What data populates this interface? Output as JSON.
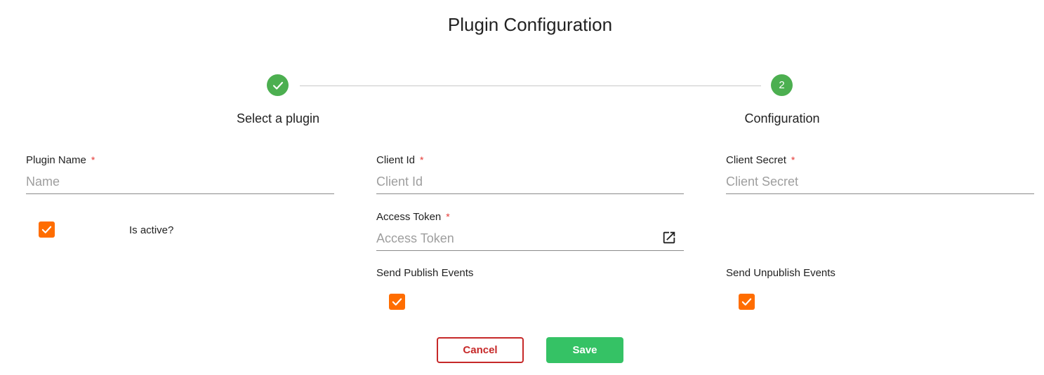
{
  "page": {
    "title": "Plugin Configuration"
  },
  "stepper": {
    "steps": [
      {
        "label": "Select a plugin",
        "status": "completed",
        "icon": "check-icon"
      },
      {
        "label": "Configuration",
        "status": "active",
        "number": "2"
      }
    ],
    "active_color": "#4caf50"
  },
  "form": {
    "plugin_name": {
      "label": "Plugin Name",
      "required_mark": "*",
      "placeholder": "Name",
      "value": ""
    },
    "client_id": {
      "label": "Client Id",
      "required_mark": "*",
      "placeholder": "Client Id",
      "value": ""
    },
    "client_secret": {
      "label": "Client Secret",
      "required_mark": "*",
      "placeholder": "Client Secret",
      "value": ""
    },
    "access_token": {
      "label": "Access Token",
      "required_mark": "*",
      "placeholder": "Access Token",
      "value": "",
      "icon": "open-in-new-icon"
    },
    "is_active": {
      "label": "Is active?",
      "checked": true
    },
    "send_publish_events": {
      "label": "Send Publish Events",
      "checked": true
    },
    "send_unpublish_events": {
      "label": "Send Unpublish Events",
      "checked": true
    }
  },
  "actions": {
    "cancel_label": "Cancel",
    "save_label": "Save"
  },
  "colors": {
    "checkbox": "#ff6d00",
    "required": "#e53935",
    "cancel": "#c62828",
    "save": "#35c265"
  }
}
